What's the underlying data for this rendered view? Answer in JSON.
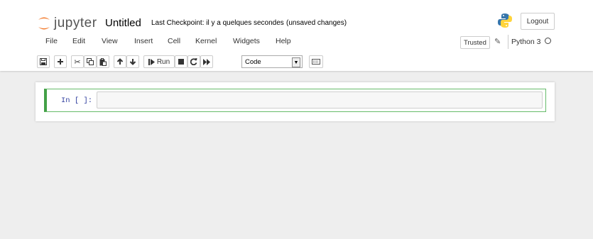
{
  "header": {
    "logo_text": "jupyter",
    "notebook_title": "Untitled",
    "checkpoint_text": "Last Checkpoint: il y a quelques secondes",
    "unsaved_text": "(unsaved changes)",
    "logout_label": "Logout"
  },
  "menu": {
    "items": [
      "File",
      "Edit",
      "View",
      "Insert",
      "Cell",
      "Kernel",
      "Widgets",
      "Help"
    ],
    "trusted_label": "Trusted",
    "kernel_name": "Python 3"
  },
  "toolbar": {
    "run_label": "Run",
    "cell_type": "Code",
    "icons": [
      "save-icon",
      "plus-icon",
      "cut-icon",
      "copy-icon",
      "paste-icon",
      "arrow-up-icon",
      "arrow-down-icon",
      "run-icon",
      "stop-icon",
      "restart-icon",
      "fast-forward-icon",
      "keyboard-icon"
    ]
  },
  "cell": {
    "prompt": "In [ ]:",
    "source": ""
  },
  "colors": {
    "cell_border": "#43a047",
    "prompt": "#303f9f",
    "logo_orange": "#f37726"
  }
}
